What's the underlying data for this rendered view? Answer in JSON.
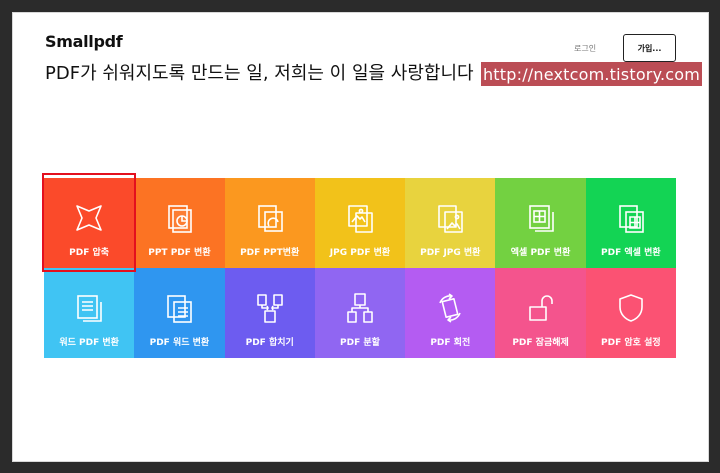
{
  "header": {
    "brand": "Smallpdf",
    "headline": "PDF가 쉬워지도록 만드는 일, 저희는 이 일을 사랑합니다",
    "login_label": "로그인",
    "signup_label": "가입..."
  },
  "watermark": {
    "text": "http://nextcom.tistory.com"
  },
  "tools": [
    {
      "label": "PDF 압축",
      "icon": "compress-icon",
      "color": "#fb4a2a",
      "selected": true
    },
    {
      "label": "PPT PDF 변환",
      "icon": "ppt-to-pdf-icon",
      "color": "#fc7323"
    },
    {
      "label": "PDF PPT변환",
      "icon": "pdf-to-ppt-icon",
      "color": "#fb981f"
    },
    {
      "label": "JPG PDF 변환",
      "icon": "jpg-to-pdf-icon",
      "color": "#f2c21a"
    },
    {
      "label": "PDF JPG 변환",
      "icon": "pdf-to-jpg-icon",
      "color": "#e8d33e"
    },
    {
      "label": "엑셀 PDF 변환",
      "icon": "excel-to-pdf-icon",
      "color": "#73d141"
    },
    {
      "label": "PDF 엑셀 변환",
      "icon": "pdf-to-excel-icon",
      "color": "#13d454"
    },
    {
      "label": "워드 PDF 변환",
      "icon": "word-to-pdf-icon",
      "color": "#40c4f3"
    },
    {
      "label": "PDF 워드 변환",
      "icon": "pdf-to-word-icon",
      "color": "#2f96f0"
    },
    {
      "label": "PDF 합치기",
      "icon": "merge-icon",
      "color": "#6d5cf0"
    },
    {
      "label": "PDF 분할",
      "icon": "split-icon",
      "color": "#9066f2"
    },
    {
      "label": "PDF 회전",
      "icon": "rotate-icon",
      "color": "#b45cf2"
    },
    {
      "label": "PDF 잠금해제",
      "icon": "unlock-icon",
      "color": "#f4548d"
    },
    {
      "label": "PDF 암호 설정",
      "icon": "protect-icon",
      "color": "#fb5273"
    }
  ]
}
